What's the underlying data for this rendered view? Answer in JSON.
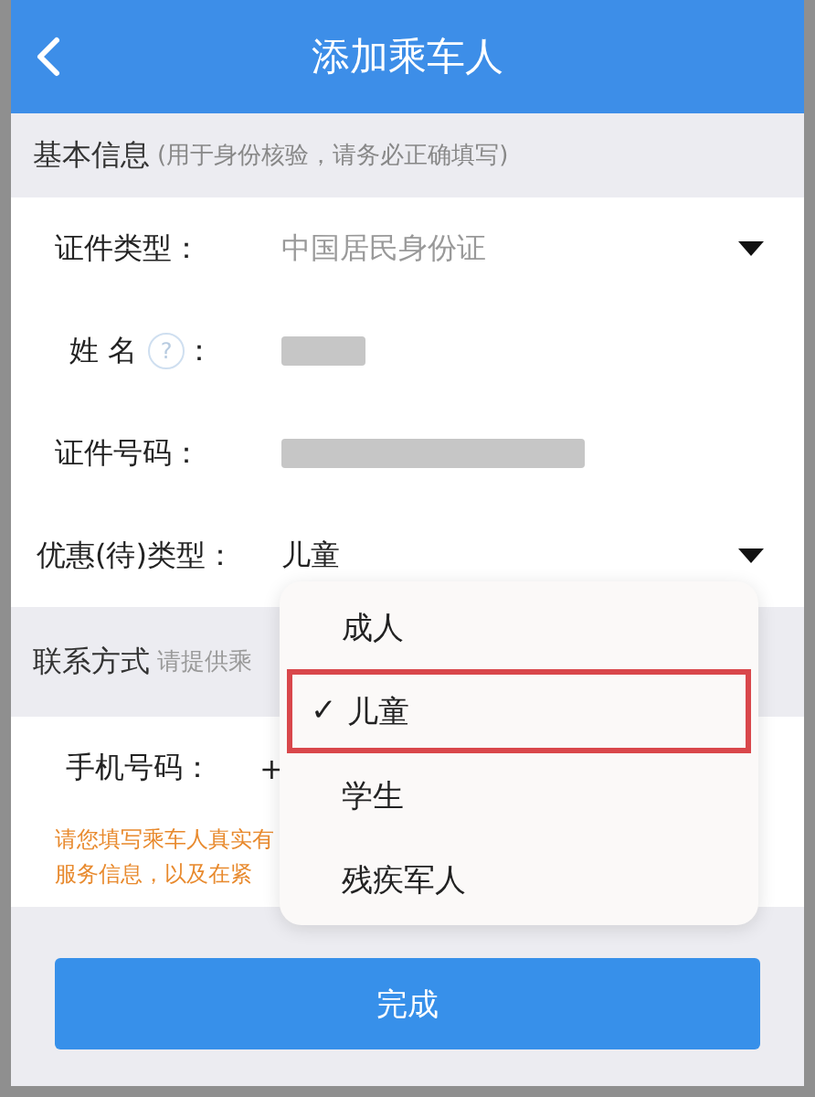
{
  "header": {
    "title": "添加乘车人"
  },
  "basic_section": {
    "title": "基本信息",
    "hint": "(用于身份核验，请务必正确填写)"
  },
  "basic_rows": [
    {
      "kind": "select",
      "label": "证件类型：",
      "placeholder": "中国居民身份证"
    },
    {
      "kind": "blurred",
      "label": "姓 名",
      "help": "?",
      "colon": "："
    },
    {
      "kind": "blurred",
      "label": "证件号码："
    },
    {
      "kind": "select",
      "label": "优惠(待)类型：",
      "value": "儿童"
    }
  ],
  "contact_section": {
    "title": "联系方式",
    "hint": "请提供乘"
  },
  "phone_row": {
    "label": "手机号码：",
    "value": "+"
  },
  "notice": [
    "请您填写乘车人真实有",
    "服务信息，以及在紧"
  ],
  "submit": "完成",
  "dropdown": [
    {
      "label": "成人",
      "selected": false
    },
    {
      "label": "儿童",
      "selected": true
    },
    {
      "label": "学生",
      "selected": false
    },
    {
      "label": "残疾军人",
      "selected": false
    }
  ],
  "check_mark": "✓"
}
